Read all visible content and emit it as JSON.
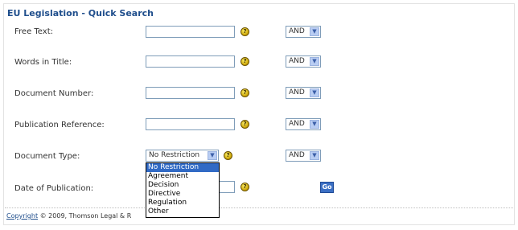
{
  "title": "EU Legislation - Quick Search",
  "fields": {
    "free_text": {
      "label": "Free Text:",
      "value": "",
      "op": "AND"
    },
    "words_in_title": {
      "label": "Words in Title:",
      "value": "",
      "op": "AND"
    },
    "document_number": {
      "label": "Document Number:",
      "value": "",
      "op": "AND"
    },
    "publication_reference": {
      "label": "Publication Reference:",
      "value": "",
      "op": "AND"
    },
    "document_type": {
      "label": "Document Type:",
      "selected": "No Restriction",
      "op": "AND"
    },
    "date_of_publication": {
      "label": "Date of Publication:",
      "value": ""
    }
  },
  "document_type_options": [
    "No Restriction",
    "Agreement",
    "Decision",
    "Directive",
    "Regulation",
    "Other"
  ],
  "help_glyph": "?",
  "dropdown_arrow": "▼",
  "go_label": "Go",
  "footer": {
    "link": "Copyright",
    "text": "© 2009, Thomson Legal & R"
  }
}
